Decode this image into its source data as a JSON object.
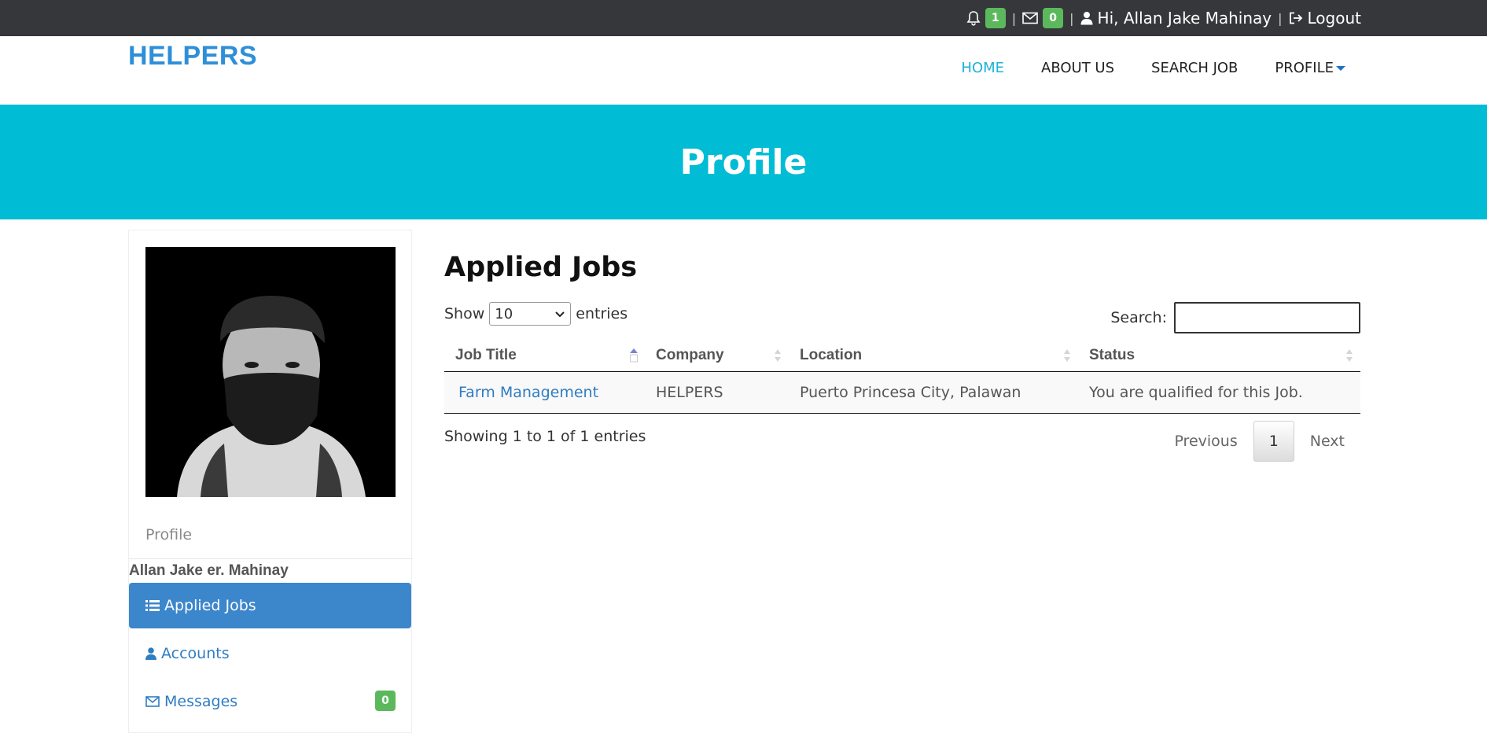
{
  "topbar": {
    "notifications_count": "1",
    "messages_count": "0",
    "separator": "|",
    "greeting": "Hi, Allan Jake Mahinay",
    "logout_label": "Logout",
    "icons": {
      "notifications": "bell-icon",
      "messages": "envelope-icon",
      "user": "user-icon",
      "logout": "sign-out-icon"
    }
  },
  "brand": {
    "name": "HELPERS",
    "color": "#2e8fd8"
  },
  "nav": {
    "items": [
      {
        "label": "HOME",
        "active": true
      },
      {
        "label": "ABOUT US",
        "active": false
      },
      {
        "label": "SEARCH JOB",
        "active": false
      },
      {
        "label": "PROFILE",
        "active": false
      }
    ],
    "active_color": "#1ab2d6"
  },
  "banner": {
    "title": "Profile",
    "color": "#00bcd4"
  },
  "sidebar": {
    "profile_label": "Profile",
    "name": "Allan Jake er. Mahinay",
    "menu": [
      {
        "label": "Applied Jobs",
        "icon": "list-icon",
        "active": true
      },
      {
        "label": "Accounts",
        "icon": "user-icon",
        "active": false
      },
      {
        "label": "Messages",
        "icon": "envelope-icon",
        "active": false,
        "badge": "0"
      }
    ]
  },
  "main": {
    "title": "Applied Jobs",
    "length": {
      "prefix": "Show",
      "selected": "10",
      "suffix": "entries"
    },
    "search": {
      "label": "Search:",
      "value": "",
      "placeholder": ""
    },
    "table": {
      "columns": [
        "Job Title",
        "Company",
        "Location",
        "Status"
      ],
      "rows": [
        {
          "job_title": "Farm Management",
          "company": "HELPERS",
          "location": "Puerto Princesa City, Palawan",
          "status": "You are qualified for this Job."
        }
      ]
    },
    "info": "Showing 1 to 1 of 1 entries",
    "pagination": {
      "previous": "Previous",
      "current": "1",
      "next": "Next"
    }
  }
}
